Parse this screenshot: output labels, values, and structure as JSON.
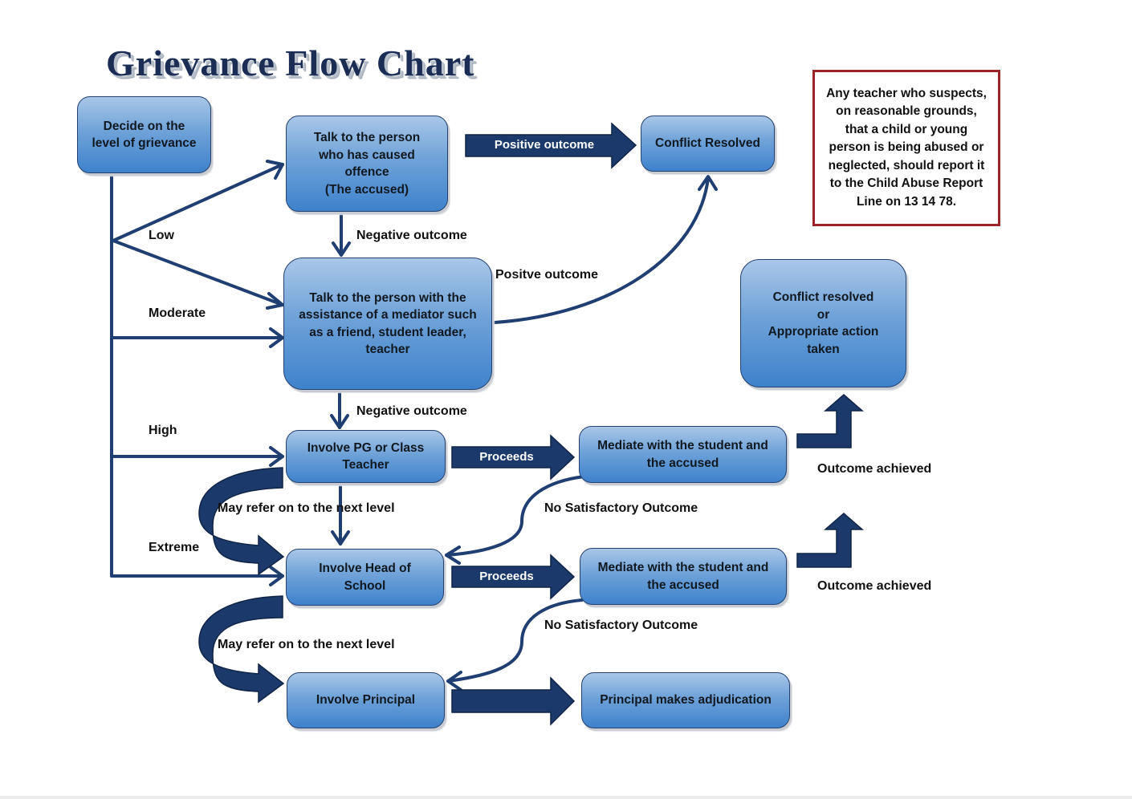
{
  "title": "Grievance Flow Chart",
  "colors": {
    "connector": "#1f3f73",
    "block_arrow": "#1b3a6b",
    "box_top": "#a9c7e8",
    "box_bottom": "#3e82cc",
    "notice_border": "#9b2226"
  },
  "boxes": {
    "decide": "Decide on the\nlevel of grievance",
    "talk_accused": "Talk to the person\nwho has caused\noffence\n(The accused)",
    "conflict_resolved": "Conflict Resolved",
    "mediator": "Talk to the person with the\nassistance of a mediator such\nas a friend, student leader,\nteacher",
    "resolved_or_action": "Conflict resolved\nor\nAppropriate action\ntaken",
    "pg_teacher": "Involve PG or Class\nTeacher",
    "mediate_1": "Mediate with the student and\nthe accused",
    "head_of_school": "Involve Head of\nSchool",
    "mediate_2": "Mediate with the student and\nthe accused",
    "principal": "Involve Principal",
    "adjudication": "Principal makes adjudication"
  },
  "levels": {
    "low": "Low",
    "moderate": "Moderate",
    "high": "High",
    "extreme": "Extreme"
  },
  "edge_labels": {
    "positive_outcome": "Positive outcome",
    "negative_outcome_1": "Negative outcome",
    "positve_outcome": "Positve outcome",
    "negative_outcome_2": "Negative outcome",
    "proceeds_1": "Proceeds",
    "proceeds_2": "Proceeds",
    "may_refer_1": "May refer on to the next level",
    "may_refer_2": "May refer on to the next level",
    "no_satisfactory_1": "No Satisfactory Outcome",
    "no_satisfactory_2": "No Satisfactory Outcome",
    "outcome_achieved_1": "Outcome achieved",
    "outcome_achieved_2": "Outcome achieved"
  },
  "notice": "Any teacher who suspects,\non reasonable grounds,\nthat a child or young\nperson is being abused or\nneglected, should report it\nto the Child Abuse Report\nLine on 13 14 78."
}
